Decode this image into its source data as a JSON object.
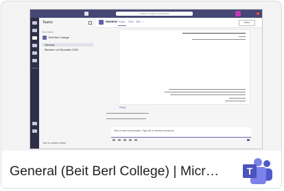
{
  "result": {
    "caption": "General (Beit Berl College) | Micr…",
    "source_logo": "microsoft-teams-logo",
    "logo_letter": "T"
  },
  "thumbnail": {
    "app": "Microsoft Teams",
    "search_placeholder": "Search or type a command",
    "sidebar_title": "Teams",
    "section_label": "Your teams",
    "team_name": "Beit Berl College",
    "channels": [
      "General",
      "Bachelor of Education 2020"
    ],
    "join_label": "Join or create a team",
    "channel_title": "General",
    "tabs": [
      "Posts",
      "Files",
      "Wiki",
      "+"
    ],
    "meet_label": "Meet",
    "reply_label": "Reply",
    "compose_placeholder": "Start a new conversation. Type @ to mention someone.",
    "accent": "#6264a7",
    "titlebar_color": "#464775",
    "rail_color": "#2f2f4a"
  }
}
